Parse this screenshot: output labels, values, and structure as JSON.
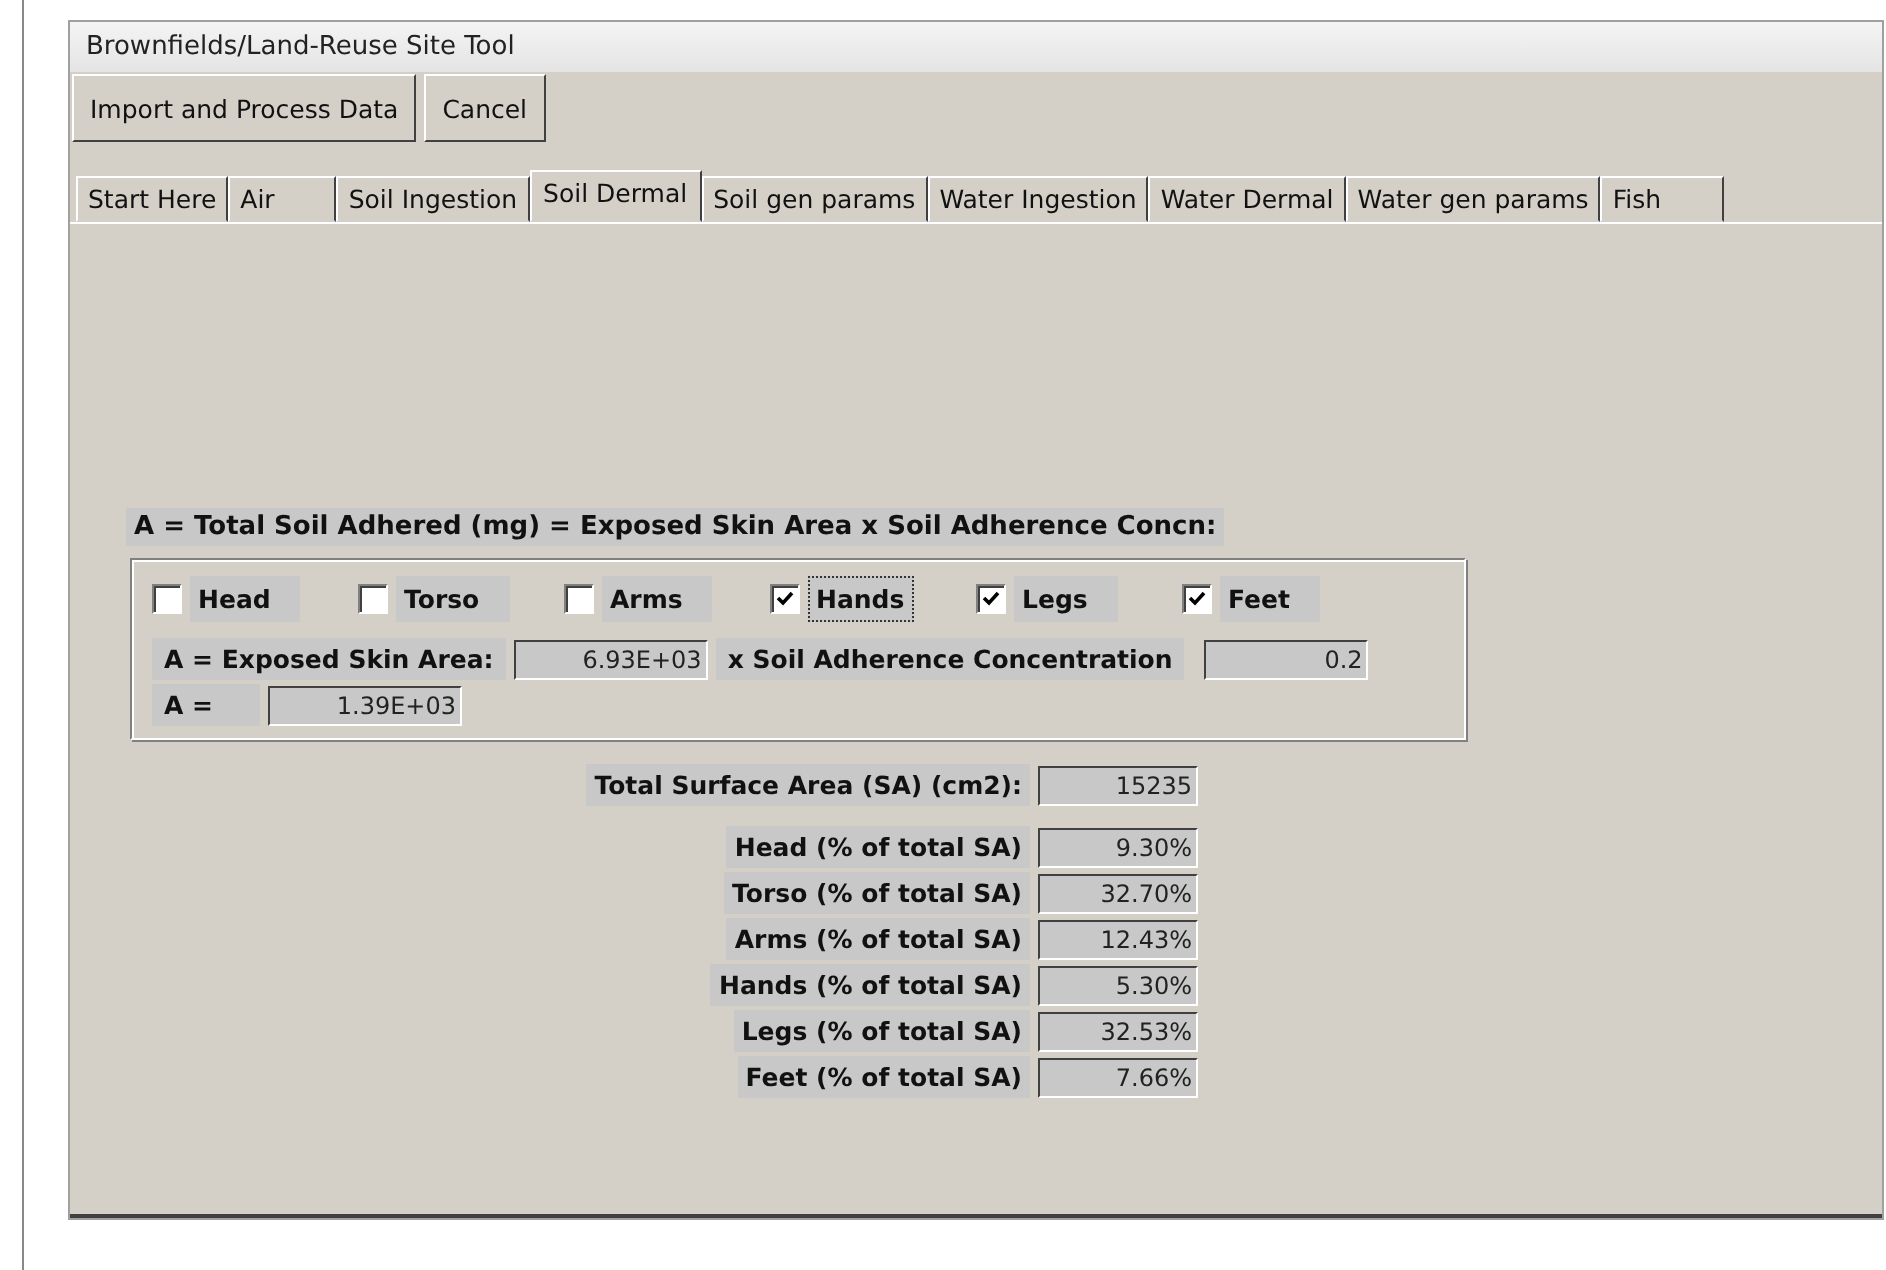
{
  "window": {
    "title": "Brownfields/Land-Reuse Site Tool"
  },
  "buttons": [
    "Import and Process Data",
    "Cancel"
  ],
  "tabs": [
    {
      "label": "Start Here",
      "selected": false
    },
    {
      "label": "Air",
      "selected": false
    },
    {
      "label": "Soil Ingestion",
      "selected": false
    },
    {
      "label": "Soil Dermal",
      "selected": true
    },
    {
      "label": "Soil gen params",
      "selected": false
    },
    {
      "label": "Water Ingestion",
      "selected": false
    },
    {
      "label": "Water Dermal",
      "selected": false
    },
    {
      "label": "Water gen params",
      "selected": false
    },
    {
      "label": "Fish",
      "selected": false
    }
  ],
  "formula_label": "A = Total Soil Adhered (mg) = Exposed Skin Area x Soil Adherence Concn:",
  "body_parts": [
    {
      "label": "Head",
      "checked": false,
      "focused": false
    },
    {
      "label": "Torso",
      "checked": false,
      "focused": false
    },
    {
      "label": "Arms",
      "checked": false,
      "focused": false
    },
    {
      "label": "Hands",
      "checked": true,
      "focused": true
    },
    {
      "label": "Legs",
      "checked": true,
      "focused": false
    },
    {
      "label": "Feet",
      "checked": true,
      "focused": false
    }
  ],
  "exposed_area": {
    "label": "A = Exposed Skin Area:",
    "value": "6.93E+03"
  },
  "adherence": {
    "label": "x Soil Adherence Concentration",
    "value": "0.2"
  },
  "result": {
    "label": "A =",
    "value": "1.39E+03"
  },
  "total_sa": {
    "label": "Total Surface Area (SA) (cm2):",
    "value": "15235"
  },
  "percentages": [
    {
      "label": "Head (% of total SA)",
      "value": "9.30%"
    },
    {
      "label": "Torso (% of total SA)",
      "value": "32.70%"
    },
    {
      "label": "Arms (% of total SA)",
      "value": "12.43%"
    },
    {
      "label": "Hands (% of total SA)",
      "value": "5.30%"
    },
    {
      "label": "Legs (% of total SA)",
      "value": "32.53%"
    },
    {
      "label": "Feet (% of total SA)",
      "value": "7.66%"
    }
  ]
}
